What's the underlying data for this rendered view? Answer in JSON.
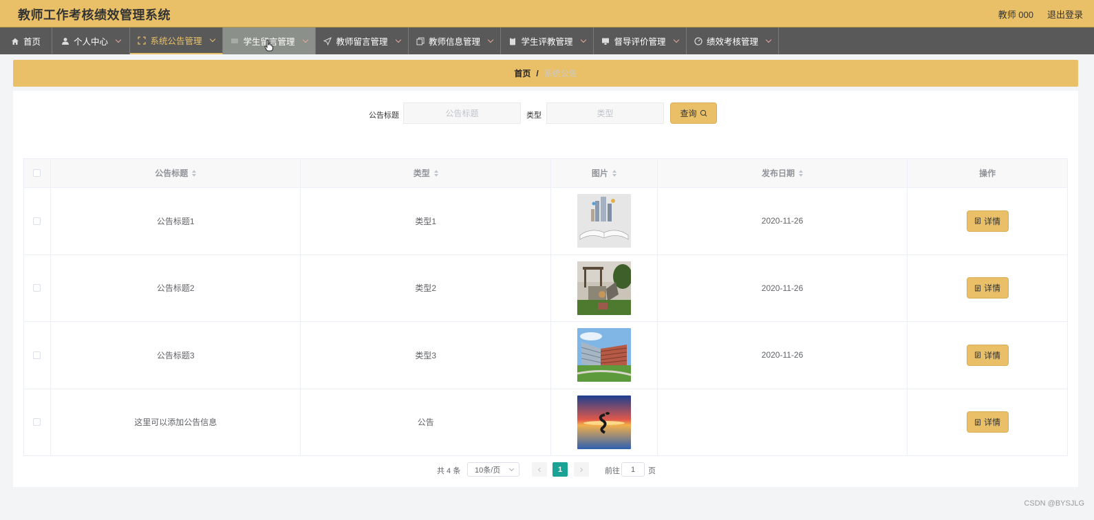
{
  "header": {
    "title": "教师工作考核绩效管理系统",
    "user": "教师 000",
    "logout": "退出登录"
  },
  "nav": [
    {
      "label": "首页",
      "icon": "home-icon",
      "dropdown": false
    },
    {
      "label": "个人中心",
      "icon": "user-icon",
      "dropdown": true
    },
    {
      "label": "系统公告管理",
      "icon": "fullscreen-icon",
      "dropdown": true
    },
    {
      "label": "学生留言管理",
      "icon": "message-icon",
      "dropdown": true
    },
    {
      "label": "教师留言管理",
      "icon": "send-icon",
      "dropdown": true
    },
    {
      "label": "教师信息管理",
      "icon": "copy-icon",
      "dropdown": true
    },
    {
      "label": "学生评教管理",
      "icon": "clipboard-icon",
      "dropdown": true
    },
    {
      "label": "督导评价管理",
      "icon": "monitor-icon",
      "dropdown": true
    },
    {
      "label": "绩效考核管理",
      "icon": "gauge-icon",
      "dropdown": true
    }
  ],
  "breadcrumb": {
    "home": "首页",
    "separator": "/",
    "current": "系统公告"
  },
  "search": {
    "title_label": "公告标题",
    "title_placeholder": "公告标题",
    "type_label": "类型",
    "type_placeholder": "类型",
    "button": "查询"
  },
  "table": {
    "headers": [
      "公告标题",
      "类型",
      "图片",
      "发布日期",
      "操作"
    ],
    "rows": [
      {
        "title": "公告标题1",
        "type": "类型1",
        "image": "book-city-image",
        "date": "2020-11-26",
        "action": "详情"
      },
      {
        "title": "公告标题2",
        "type": "类型2",
        "image": "garden-sculpture-image",
        "date": "2020-11-26",
        "action": "详情"
      },
      {
        "title": "公告标题3",
        "type": "类型3",
        "image": "campus-building-image",
        "date": "2020-11-26",
        "action": "详情"
      },
      {
        "title": "这里可以添加公告信息",
        "type": "公告",
        "image": "sunset-reflection-image",
        "date": "",
        "action": "详情"
      }
    ]
  },
  "pagination": {
    "total": "共 4 条",
    "page_size": "10条/页",
    "current": "1",
    "goto_label": "前往",
    "goto_value": "1",
    "page_unit": "页"
  },
  "watermark": "CSDN @BYSJLG",
  "colors": {
    "accent": "#e9c068",
    "nav_bg": "#595959",
    "pager_active": "#1aa394"
  }
}
